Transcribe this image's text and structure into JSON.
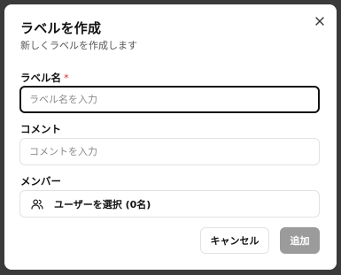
{
  "dialog": {
    "title": "ラベルを作成",
    "subtitle": "新しくラベルを作成します",
    "close_icon": "close-icon"
  },
  "form": {
    "label_name": {
      "label": "ラベル名",
      "required_mark": "*",
      "placeholder": "ラベル名を入力",
      "value": ""
    },
    "comment": {
      "label": "コメント",
      "placeholder": "コメントを入力",
      "value": ""
    },
    "members": {
      "label": "メンバー",
      "select_label": "ユーザーを選択 (0名)",
      "icon": "users-icon"
    }
  },
  "actions": {
    "cancel_label": "キャンセル",
    "add_label": "追加"
  },
  "colors": {
    "backdrop": "#3a3a3a",
    "required": "#d9363e",
    "add_button_disabled": "#9b9b9b"
  }
}
